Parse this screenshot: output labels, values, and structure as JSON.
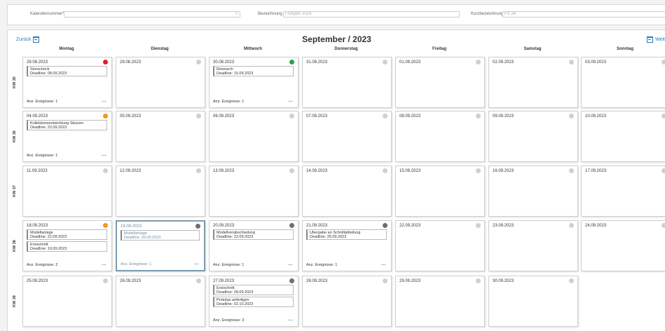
{
  "filters": {
    "kalendernummer": {
      "label": "Kalendernummer*",
      "value": "",
      "suffix": "0"
    },
    "bezeichnung": {
      "label": "Bezeichnung",
      "value": "Frühjahr 2024"
    },
    "kurzbezeichnung": {
      "label": "Kurzbezeichnung",
      "value": "FS 24"
    }
  },
  "nav": {
    "back_label": "Zurück",
    "next_label": "Weit",
    "title": "September / 2023"
  },
  "weekdays": [
    "Montag",
    "Dienstag",
    "Mittwoch",
    "Donnerstag",
    "Freitag",
    "Samstag",
    "Sonntag"
  ],
  "weeks": [
    {
      "kw": "KW 35",
      "days": [
        {
          "date": "28.08.2023",
          "status": "red",
          "events": [
            {
              "title": "Storecheck",
              "deadline": "Deadline: 08.09.2023"
            }
          ],
          "count": "Anz. Ereignisse: 1"
        },
        {
          "date": "29.08.2023",
          "status": "grey",
          "events": [],
          "count": ""
        },
        {
          "date": "30.08.2023",
          "status": "green",
          "events": [
            {
              "title": "Research",
              "deadline": "Deadline: 15.09.2023"
            }
          ],
          "count": "Anz. Ereignisse: 1"
        },
        {
          "date": "31.08.2023",
          "status": "grey",
          "events": [],
          "count": ""
        },
        {
          "date": "01.09.2023",
          "status": "grey",
          "events": [],
          "count": ""
        },
        {
          "date": "02.09.2023",
          "status": "grey",
          "events": [],
          "count": ""
        },
        {
          "date": "03.09.2023",
          "status": "grey",
          "events": [],
          "count": ""
        }
      ]
    },
    {
      "kw": "KW 36",
      "days": [
        {
          "date": "04.09.2023",
          "status": "orange",
          "events": [
            {
              "title": "Kollektionsentwicklung Skizzen",
              "deadline": "Deadline: 22.09.2023"
            }
          ],
          "count": "Anz. Ereignisse: 1"
        },
        {
          "date": "05.09.2023",
          "status": "grey",
          "events": [],
          "count": ""
        },
        {
          "date": "06.09.2023",
          "status": "grey",
          "events": [],
          "count": ""
        },
        {
          "date": "07.09.2023",
          "status": "grey",
          "events": [],
          "count": ""
        },
        {
          "date": "08.09.2023",
          "status": "grey",
          "events": [],
          "count": ""
        },
        {
          "date": "09.09.2023",
          "status": "grey",
          "events": [],
          "count": ""
        },
        {
          "date": "10.09.2023",
          "status": "grey",
          "events": [],
          "count": ""
        }
      ]
    },
    {
      "kw": "KW 37",
      "days": [
        {
          "date": "11.09.2023",
          "status": "grey",
          "events": [],
          "count": ""
        },
        {
          "date": "12.09.2023",
          "status": "grey",
          "events": [],
          "count": ""
        },
        {
          "date": "13.09.2023",
          "status": "grey",
          "events": [],
          "count": ""
        },
        {
          "date": "14.09.2023",
          "status": "grey",
          "events": [],
          "count": ""
        },
        {
          "date": "15.09.2023",
          "status": "grey",
          "events": [],
          "count": ""
        },
        {
          "date": "16.09.2023",
          "status": "grey",
          "events": [],
          "count": ""
        },
        {
          "date": "17.09.2023",
          "status": "grey",
          "events": [],
          "count": ""
        }
      ]
    },
    {
      "kw": "KW 38",
      "days": [
        {
          "date": "18.09.2023",
          "status": "orange",
          "events": [
            {
              "title": "Modellanlage",
              "deadline": "Deadline: 22.09.2023"
            },
            {
              "title": "Erstschnitt",
              "deadline": "Deadline: 19.09.2023"
            }
          ],
          "count": "Anz. Ereignisse: 2"
        },
        {
          "date": "19.09.2023",
          "status": "dark",
          "selected": true,
          "events": [
            {
              "title": "Modellanlage",
              "deadline": "Deadline: 20.09.2023"
            }
          ],
          "count": "Anz. Ereignisse: 1"
        },
        {
          "date": "20.09.2023",
          "status": "dark",
          "events": [
            {
              "title": "Modellverabschiedung",
              "deadline": "Deadline: 22.09.2023"
            }
          ],
          "count": "Anz. Ereignisse: 1"
        },
        {
          "date": "21.09.2023",
          "status": "dark",
          "events": [
            {
              "title": "Übergabe an Schnittabteilung",
              "deadline": "Deadline: 25.09.2023"
            }
          ],
          "count": "Anz. Ereignisse: 1"
        },
        {
          "date": "22.09.2023",
          "status": "grey",
          "events": [],
          "count": ""
        },
        {
          "date": "23.09.2023",
          "status": "grey",
          "events": [],
          "count": ""
        },
        {
          "date": "24.09.2023",
          "status": "grey",
          "events": [],
          "count": ""
        }
      ]
    },
    {
      "kw": "KW 39",
      "days": [
        {
          "date": "25.09.2023",
          "status": "grey",
          "events": [],
          "count": ""
        },
        {
          "date": "26.09.2023",
          "status": "grey",
          "events": [],
          "count": ""
        },
        {
          "date": "27.09.2023",
          "status": "dark",
          "events": [
            {
              "title": "Erstschnitt",
              "deadline": "Deadline: 28.09.2023"
            },
            {
              "title": "Prototyp anfertigen",
              "deadline": "Deadline: 02.10.2023"
            }
          ],
          "count": "Anz. Ereignisse: 3"
        },
        {
          "date": "28.09.2023",
          "status": "grey",
          "events": [],
          "count": ""
        },
        {
          "date": "29.09.2023",
          "status": "grey",
          "events": [],
          "count": ""
        },
        {
          "date": "30.09.2023",
          "status": "grey",
          "events": [],
          "count": ""
        }
      ]
    }
  ],
  "more_label": "···",
  "colors": {
    "accent": "#2b7bb9",
    "red": "#e31e24",
    "green": "#1fa84a",
    "orange": "#f29a1a",
    "dark": "#6e6e6e",
    "grey": "#d0d0d0"
  }
}
